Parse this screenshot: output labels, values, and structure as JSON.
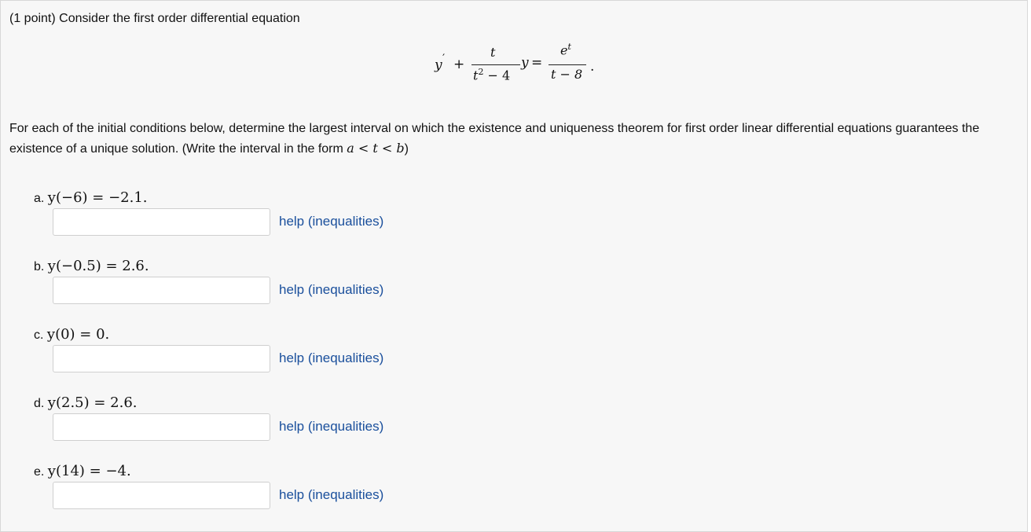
{
  "problem": {
    "intro": "(1 point) Consider the first order differential equation",
    "equation": {
      "lhs_y": "y",
      "prime": "′",
      "plus": "+",
      "frac1_num": "t",
      "frac1_den_base": "t",
      "frac1_den_exp": "2",
      "frac1_den_rest": " − 4",
      "y_term": "y",
      "equals": "=",
      "frac2_num_base": "e",
      "frac2_num_exp": "t",
      "frac2_den": "t − 8",
      "period": "."
    },
    "instructions_1": "For each of the initial conditions below, determine the largest interval on which the existence and uniqueness theorem for first order linear differential equations guarantees the existence of a unique solution. (Write the interval in the form ",
    "instructions_math": "a < t < b",
    "instructions_2": ")"
  },
  "parts": [
    {
      "label": "a.",
      "condition": "y(−6) = −2.1.",
      "value": "",
      "help": "help (inequalities)"
    },
    {
      "label": "b.",
      "condition": "y(−0.5) = 2.6.",
      "value": "",
      "help": "help (inequalities)"
    },
    {
      "label": "c.",
      "condition": "y(0) = 0.",
      "value": "",
      "help": "help (inequalities)"
    },
    {
      "label": "d.",
      "condition": "y(2.5) = 2.6.",
      "value": "",
      "help": "help (inequalities)"
    },
    {
      "label": "e.",
      "condition": "y(14) = −4.",
      "value": "",
      "help": "help (inequalities)"
    }
  ],
  "colors": {
    "link": "#1a4f9c",
    "input_border": "#cfcfcf",
    "panel_bg": "#f7f7f7"
  }
}
